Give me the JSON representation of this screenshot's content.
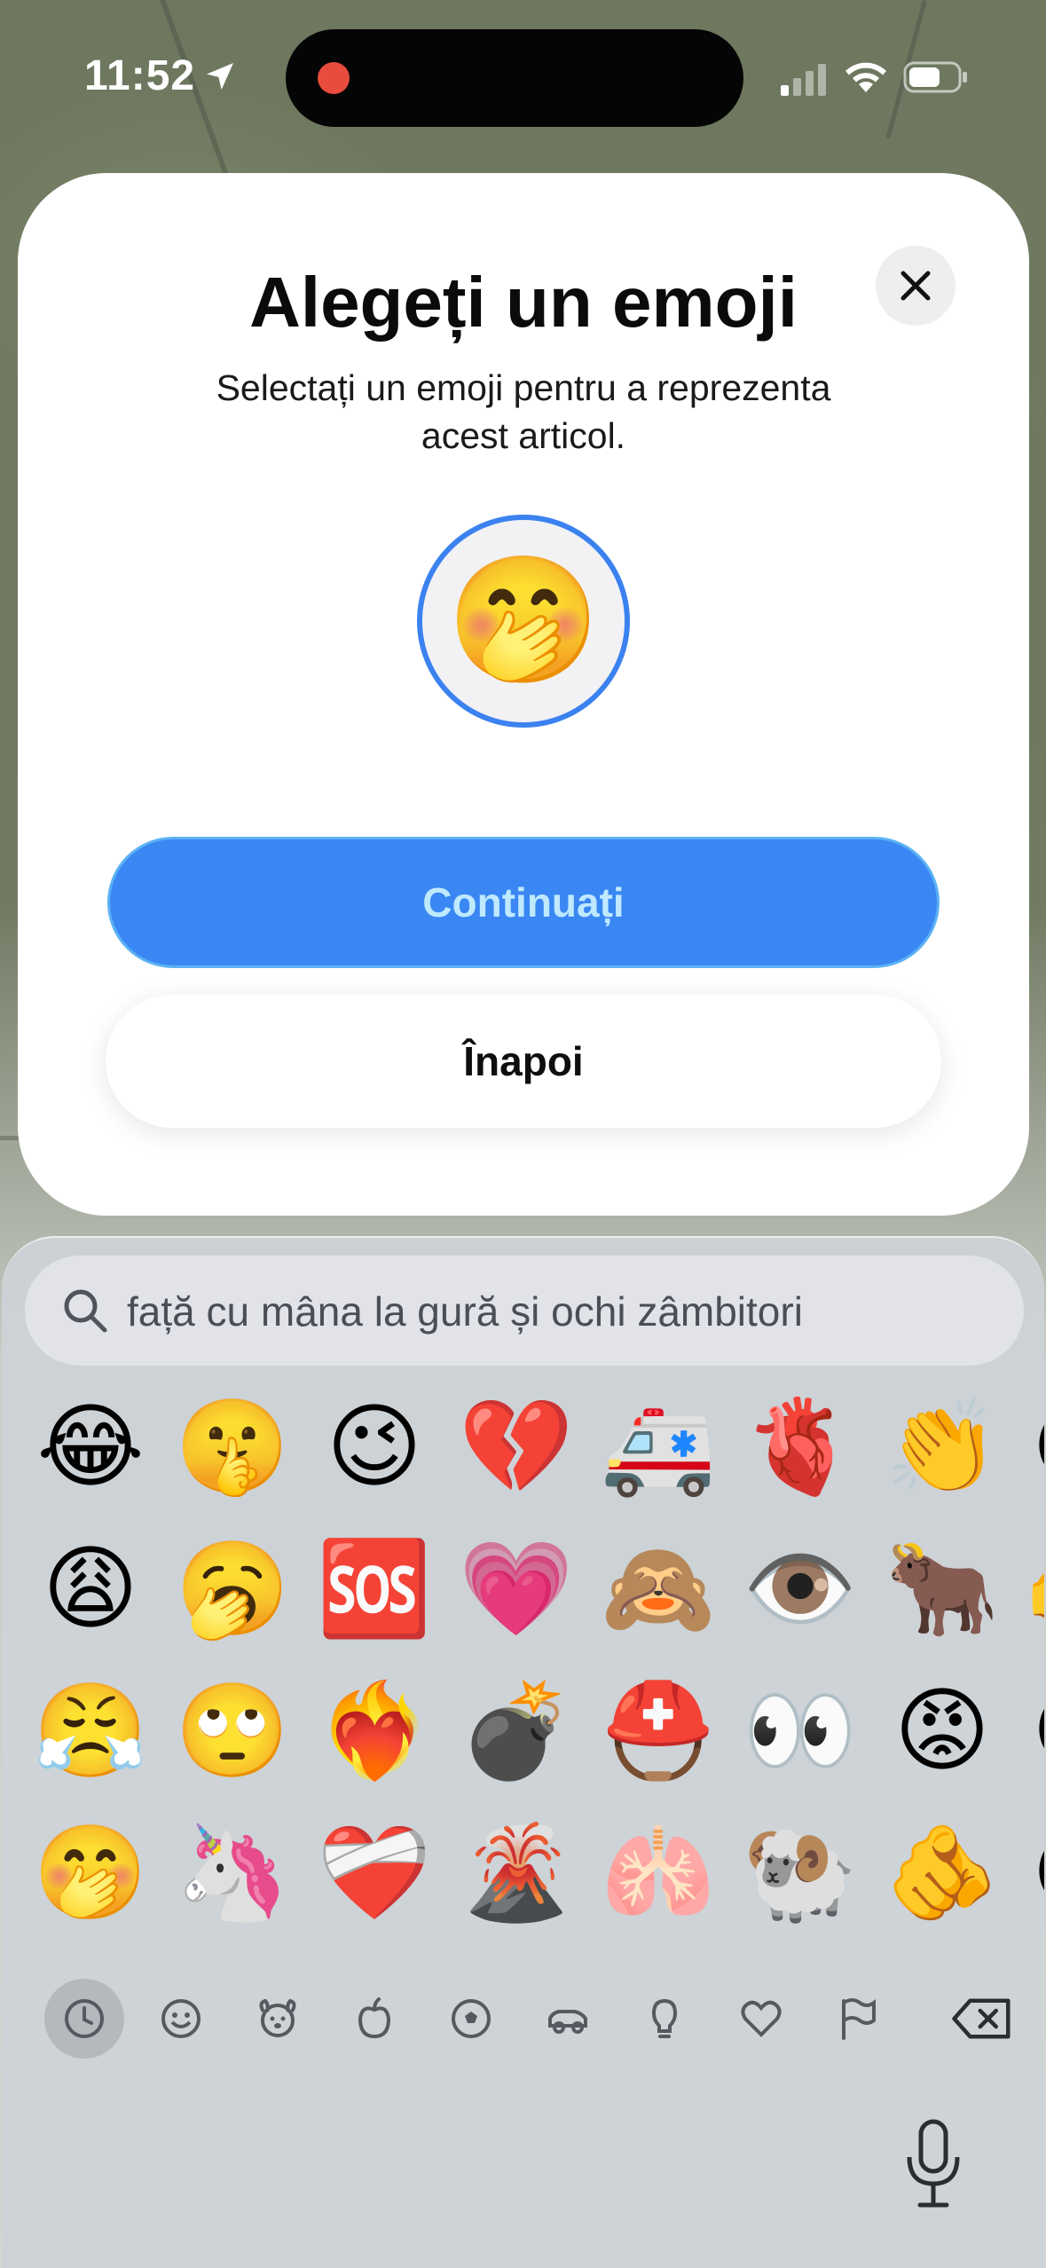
{
  "status_bar": {
    "time": "11:52",
    "icons": [
      "location-arrow-icon",
      "signal-icon",
      "wifi-icon",
      "battery-icon"
    ],
    "recording_indicator_color": "#e74c3c"
  },
  "modal": {
    "title": "Alegeți un emoji",
    "subtitle": "Selectați un emoji pentru a reprezenta acest articol.",
    "selected_emoji": "🤭",
    "continue_label": "Continuați",
    "back_label": "Înapoi",
    "accent_color": "#3a87f3"
  },
  "keyboard": {
    "search_text": "față cu mâna la gură și ochi zâmbitori",
    "emoji_rows": [
      [
        "😂",
        "🤫",
        "😉",
        "💔",
        "🚑",
        "🫀",
        "👏",
        "😊"
      ],
      [
        "😩",
        "🥱",
        "🆘",
        "💗",
        "🙈",
        "👁️",
        "🐂",
        "👉"
      ],
      [
        "😤",
        "🙄",
        "❤️‍🔥",
        "💣",
        "⛑️",
        "👀",
        "😡",
        "😢"
      ],
      [
        "🤭",
        "🦄",
        "❤️‍🩹",
        "🌋",
        "🫁",
        "🐏",
        "🫵",
        "😀"
      ]
    ],
    "categories": [
      "recent-icon",
      "smiley-icon",
      "animal-icon",
      "food-icon",
      "sports-icon",
      "travel-icon",
      "objects-icon",
      "symbols-icon",
      "flags-icon"
    ],
    "active_category": "recent-icon",
    "delete_icon": "delete-icon",
    "mic_icon": "microphone-icon"
  }
}
